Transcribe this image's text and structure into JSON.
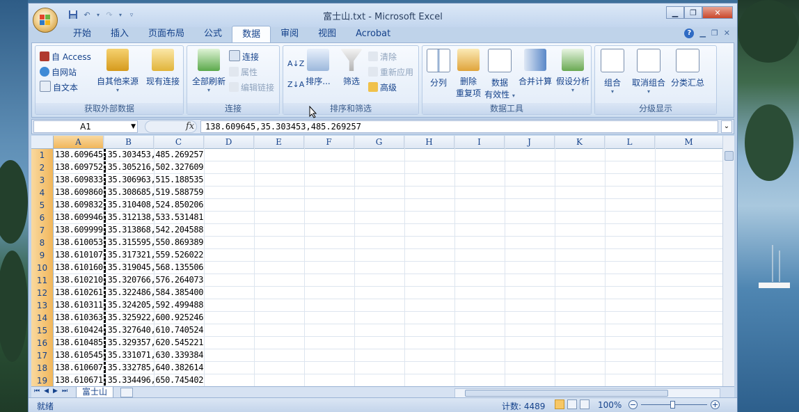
{
  "window": {
    "title": "富士山.txt - Microsoft Excel"
  },
  "quick_access": {
    "icons": [
      "save-icon",
      "undo-icon",
      "redo-icon",
      "customize-icon"
    ]
  },
  "ribbon_tabs": [
    "开始",
    "插入",
    "页面布局",
    "公式",
    "数据",
    "审阅",
    "视图",
    "Acrobat"
  ],
  "active_tab": "数据",
  "groups": {
    "external": {
      "label": "获取外部数据",
      "access": "自 Access",
      "web": "自网站",
      "text": "自文本",
      "other": "自其他来源",
      "existing": "现有连接"
    },
    "connections": {
      "label": "连接",
      "refresh": "全部刷新",
      "connections": "连接",
      "properties": "属性",
      "edit_links": "编辑链接"
    },
    "sort_filter": {
      "label": "排序和筛选",
      "sort": "排序...",
      "filter": "筛选",
      "clear": "清除",
      "reapply": "重新应用",
      "advanced": "高级"
    },
    "data_tools": {
      "label": "数据工具",
      "text_to_columns": "分列",
      "remove_dup_1": "删除",
      "remove_dup_2": "重复项",
      "validation_1": "数据",
      "validation_2": "有效性",
      "consolidate": "合并计算",
      "what_if": "假设分析"
    },
    "outline": {
      "label": "分级显示",
      "group": "组合",
      "ungroup": "取消组合",
      "subtotal": "分类汇总"
    }
  },
  "formula_bar": {
    "name_box": "A1",
    "fx": "fx",
    "formula": "138.609645,35.303453,485.269257"
  },
  "columns": [
    "A",
    "B",
    "C",
    "D",
    "E",
    "F",
    "G",
    "H",
    "I",
    "J",
    "K",
    "L",
    "M"
  ],
  "selected_column": "A",
  "rows": [
    {
      "n": "1",
      "a": "138.609645,35.303453,485.269257"
    },
    {
      "n": "2",
      "a": "138.609752,35.305216,502.327609"
    },
    {
      "n": "3",
      "a": "138.609833,35.306963,515.188535"
    },
    {
      "n": "4",
      "a": "138.609860,35.308685,519.588759"
    },
    {
      "n": "5",
      "a": "138.609832,35.310408,524.850206"
    },
    {
      "n": "6",
      "a": "138.609946,35.312138,533.531481"
    },
    {
      "n": "7",
      "a": "138.609999,35.313868,542.204588"
    },
    {
      "n": "8",
      "a": "138.610053,35.315595,550.869389"
    },
    {
      "n": "9",
      "a": "138.610107,35.317321,559.526022"
    },
    {
      "n": "10",
      "a": "138.610160,35.319045,568.135506"
    },
    {
      "n": "11",
      "a": "138.610210,35.320766,576.264073"
    },
    {
      "n": "12",
      "a": "138.610261,35.322486,584.385400"
    },
    {
      "n": "13",
      "a": "138.610311,35.324205,592.499488"
    },
    {
      "n": "14",
      "a": "138.610363,35.325922,600.925246"
    },
    {
      "n": "15",
      "a": "138.610424,35.327640,610.740524"
    },
    {
      "n": "16",
      "a": "138.610485,35.329357,620.545221"
    },
    {
      "n": "17",
      "a": "138.610545,35.331071,630.339384"
    },
    {
      "n": "18",
      "a": "138.610607,35.332785,640.382614"
    },
    {
      "n": "19",
      "a": "138.610671,35.334496,650.745402"
    }
  ],
  "sheet_tab": "富士山",
  "status": {
    "left": "就绪",
    "count": "计数: 4489",
    "zoom": "100%"
  },
  "colors": {
    "ribbon_accent": "#15428b",
    "selected_header": "#f1b65b",
    "close_button": "#c9472b"
  }
}
